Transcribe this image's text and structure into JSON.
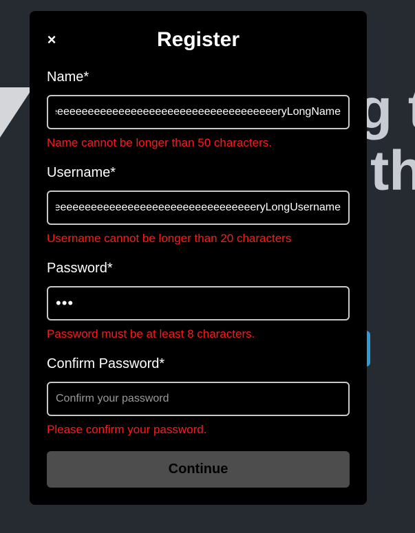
{
  "background": {
    "heading_line1": "g t",
    "heading_line2": "th"
  },
  "modal": {
    "close_label": "×",
    "title": "Register",
    "fields": {
      "name": {
        "label": "Name*",
        "value": "VeryLoooooooooooooooooooooooooooooooooooooooooooooooooeeeeeeeeeeeeeeeeeeeeeeeeeeeeeeeeeeeeeeeeeeeeeryLongName",
        "error": "Name cannot be longer than 50 characters."
      },
      "username": {
        "label": "Username*",
        "value": "VeryLoooooooooooooooooooooooooooooooooooooeeeeeeeeeeeeeeeeeeeeeeeeeeeeeeeeeeeeeeeeeeeeeryLongUsername",
        "error": "Username cannot be longer than 20 characters"
      },
      "password": {
        "label": "Password*",
        "value": "abc",
        "error": "Password must be at least 8 characters."
      },
      "confirm_password": {
        "label": "Confirm Password*",
        "value": "",
        "placeholder": "Confirm your password",
        "error": "Please confirm your password."
      }
    },
    "continue_label": "Continue"
  },
  "colors": {
    "page_background": "#262a31",
    "modal_background": "#000000",
    "error": "#ff1a1a",
    "button_disabled": "#4d4d4d",
    "accent": "#2e9bd6"
  }
}
